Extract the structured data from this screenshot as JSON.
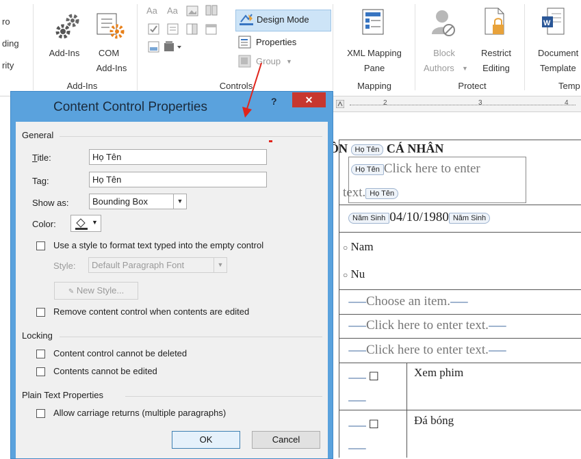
{
  "ribbon": {
    "partial_left": [
      "ro",
      "ding",
      "rity"
    ],
    "addins_label": "Add-Ins",
    "com_label": "COM",
    "com_label2": "Add-Ins",
    "addins_group": "Add-Ins",
    "controls_group": "Controls",
    "aa1": "Aa",
    "aa2": "Aa",
    "design_mode": "Design Mode",
    "properties": "Properties",
    "group": "Group",
    "xml_label": "XML Mapping",
    "xml_label2": "Pane",
    "mapping_group": "Mapping",
    "block_label": "Block",
    "block_label2": "Authors",
    "restrict_label": "Restrict",
    "restrict_label2": "Editing",
    "protect_group": "Protect",
    "doc_label": "Document",
    "doc_label2": "Template",
    "temp_group": "Temp"
  },
  "ruler": {
    "marks": [
      "2",
      "3",
      "4"
    ]
  },
  "document": {
    "header_prefix": "ÔN",
    "header_tag": "Họ Tên",
    "header_text": "CÁ NHÂN",
    "row1_tag_open": "Họ Tên",
    "row1_text_a": "Click here to enter",
    "row1_text_b": "text.",
    "row1_tag_close": "Họ Tên",
    "row2_tag_open": "Năm Sinh",
    "row2_value": "04/10/1980",
    "row2_tag_close": "Năm Sinh",
    "radio1": "Nam",
    "radio2": "Nu",
    "combo_placeholder": "Choose an item.",
    "text_placeholder1": "Click here to enter text.",
    "text_placeholder2": "Click here to enter text.",
    "item1": "Xem phim",
    "item2": "Đá bóng"
  },
  "dialog": {
    "title": "Content Control Properties",
    "help": "?",
    "close": "✕",
    "general": "General",
    "title_label": "Title:",
    "title_value": "Họ Tên",
    "tag_label": "Tag:",
    "tag_value": "Họ Tên",
    "show_as_label": "Show as:",
    "show_as_value": "Bounding Box",
    "color_label": "Color:",
    "use_style": "Use a style to format text typed into the empty control",
    "style_label": "Style:",
    "style_value": "Default Paragraph Font",
    "new_style": "New Style...",
    "remove_cc": "Remove content control when contents are edited",
    "locking": "Locking",
    "lock_delete": "Content control cannot be deleted",
    "lock_edit": "Contents cannot be edited",
    "plain_text": "Plain Text Properties",
    "allow_cr": "Allow carriage returns (multiple paragraphs)",
    "ok": "OK",
    "cancel": "Cancel"
  },
  "colors": {
    "dialog_frame": "#5aa2dd",
    "close_button": "#c7372f",
    "design_mode_highlight": "#cde4f7",
    "annotation_arrow": "#e0241b"
  },
  "icons": [
    "gear-icon",
    "com-addin-icon",
    "design-mode-icon",
    "properties-icon",
    "group-icon",
    "xml-mapping-icon",
    "block-authors-icon",
    "restrict-editing-icon",
    "document-template-icon",
    "paint-bucket-icon",
    "dropdown-arrow-icon",
    "radio-icon",
    "checkbox-icon",
    "annotation-arrow"
  ]
}
